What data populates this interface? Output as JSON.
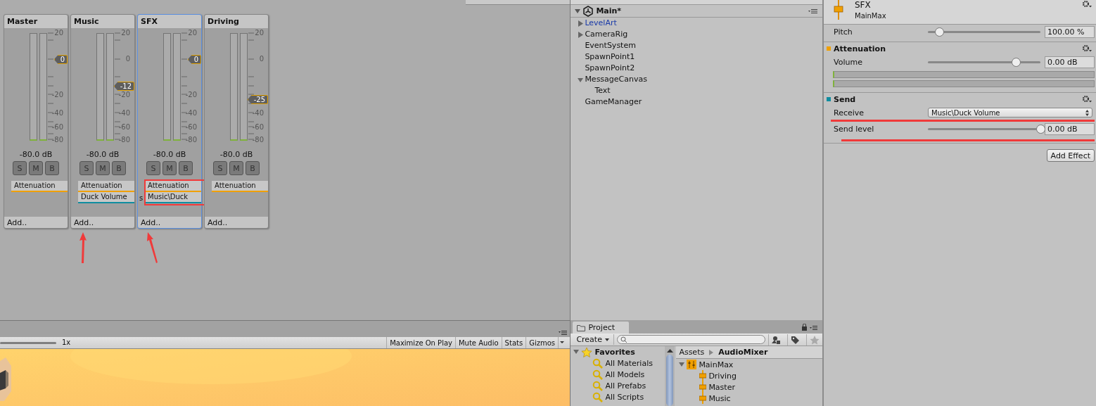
{
  "mixer": {
    "strips": [
      {
        "name": "Master",
        "selected": false,
        "fader": {
          "value": "0",
          "level": 0.755
        },
        "scale": {
          "mark_20": "20",
          "mark_m20": "-20",
          "mark_m40": "-40",
          "mark_m60": "-60",
          "mark_m80": "-80"
        },
        "reading": "-80.0 dB",
        "buttons": [
          "S",
          "M",
          "B"
        ],
        "effects": [
          {
            "name": "Attenuation",
            "color": "#f0a000"
          }
        ],
        "effects_boxed": false,
        "add": "Add..",
        "arrow_marked": false
      },
      {
        "name": "Music",
        "selected": false,
        "fader": {
          "value": "-12",
          "level": 0.503
        },
        "scale": {
          "mark_20": "20",
          "mark_0": "0",
          "mark_m20": "-20",
          "mark_m40": "-40",
          "mark_m60": "-60",
          "mark_m80": "-80"
        },
        "reading": "-80.0 dB",
        "buttons": [
          "S",
          "M",
          "B"
        ],
        "effects": [
          {
            "name": "Attenuation",
            "color": "#f0a000"
          },
          {
            "name": "Duck Volume",
            "color": "#108da0"
          }
        ],
        "effects_boxed": false,
        "add": "Add..",
        "arrow_marked": true
      },
      {
        "name": "SFX",
        "selected": true,
        "fader": {
          "value": "0",
          "level": 0.755
        },
        "scale": {
          "mark_20": "20",
          "mark_m20": "-20",
          "mark_m40": "-40",
          "mark_m60": "-60",
          "mark_m80": "-80"
        },
        "reading": "-80.0 dB",
        "buttons": [
          "S",
          "M",
          "B"
        ],
        "effects": [
          {
            "name": "Attenuation",
            "color": "#f0a000"
          },
          {
            "name": "Music\\Duck",
            "color": "#108da0",
            "prefix": "s"
          }
        ],
        "effects_boxed": true,
        "add": "Add..",
        "arrow_marked": true
      },
      {
        "name": "Driving",
        "selected": false,
        "fader": {
          "value": "-25",
          "level": 0.377
        },
        "scale": {
          "mark_20": "20",
          "mark_0": "0",
          "mark_m40": "-40",
          "mark_m60": "-60",
          "mark_m80": "-80"
        },
        "reading": "-80.0 dB",
        "buttons": [
          "S",
          "M",
          "B"
        ],
        "effects": [
          {
            "name": "Attenuation",
            "color": "#f0a000"
          }
        ],
        "effects_boxed": false,
        "add": "Add..",
        "arrow_marked": false
      }
    ]
  },
  "game_view": {
    "scale_label": "1x",
    "buttons": [
      "Maximize On Play",
      "Mute Audio",
      "Stats",
      "Gizmos"
    ]
  },
  "hierarchy": {
    "scene": "Main*",
    "items": [
      {
        "name": "LevelArt",
        "prefab": true,
        "expanded": false
      },
      {
        "name": "CameraRig",
        "prefab": false,
        "expanded": false
      },
      {
        "name": "EventSystem",
        "prefab": false
      },
      {
        "name": "SpawnPoint1",
        "prefab": false
      },
      {
        "name": "SpawnPoint2",
        "prefab": false
      },
      {
        "name": "MessageCanvas",
        "prefab": false,
        "expanded": true,
        "children": [
          {
            "name": "Text",
            "prefab": false
          }
        ]
      },
      {
        "name": "GameManager",
        "prefab": false
      }
    ]
  },
  "project": {
    "tab": "Project",
    "create": "Create",
    "favorites": {
      "title": "Favorites",
      "items": [
        "All Materials",
        "All Models",
        "All Prefabs",
        "All Scripts"
      ]
    },
    "breadcrumb": [
      "Assets",
      "AudioMixer"
    ],
    "mixer_asset": {
      "name": "MainMax",
      "children": [
        "Driving",
        "Master",
        "Music"
      ]
    }
  },
  "inspector": {
    "title": "SFX",
    "subtitle": "MainMax",
    "pitch": {
      "label": "Pitch",
      "level": 0.1,
      "value": "100.00 %"
    },
    "sections": [
      {
        "title": "Attenuation",
        "color": "#f0a000",
        "rows": [
          {
            "kind": "slider",
            "label": "Volume",
            "level": 0.78,
            "value": "0.00 dB",
            "underlined": false
          },
          {
            "kind": "meters"
          }
        ]
      },
      {
        "title": "Send",
        "color": "#108da0",
        "rows": [
          {
            "kind": "dropdown",
            "label": "Receive",
            "value": "Music\\Duck Volume",
            "underlined": true
          },
          {
            "kind": "slider",
            "label": "Send level",
            "level": 1.0,
            "value": "0.00 dB",
            "underlined": true
          }
        ]
      }
    ],
    "add_button": "Add Effect"
  }
}
